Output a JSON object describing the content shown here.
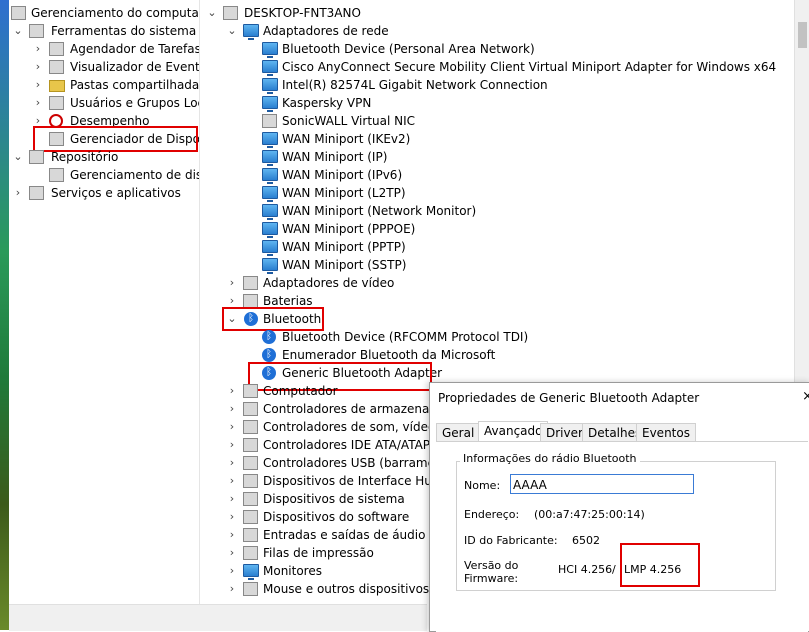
{
  "left_tree": {
    "root": "Gerenciamento do computador",
    "ferramentas": "Ferramentas do sistema",
    "agendador": "Agendador de Tarefas",
    "visualizador": "Visualizador de Eventos",
    "pastas": "Pastas compartilhadas",
    "usuarios": "Usuários e Grupos Locais",
    "desempenho": "Desempenho",
    "gerenciador": "Gerenciador de Dispositivos",
    "repositorio": "Repositório",
    "gerenciador_disco": "Gerenciamento de disco",
    "servicos": "Serviços e aplicativos"
  },
  "device_tree": {
    "computer": "DESKTOP-FNT3ANO",
    "network_category": "Adaptadores de rede",
    "network_items": [
      "Bluetooth Device (Personal Area Network)",
      "Cisco AnyConnect Secure Mobility Client Virtual Miniport Adapter for Windows x64",
      "Intel(R) 82574L Gigabit Network Connection",
      "Kaspersky VPN",
      "SonicWALL Virtual NIC",
      "WAN Miniport (IKEv2)",
      "WAN Miniport (IP)",
      "WAN Miniport (IPv6)",
      "WAN Miniport (L2TP)",
      "WAN Miniport (Network Monitor)",
      "WAN Miniport (PPPOE)",
      "WAN Miniport (PPTP)",
      "WAN Miniport (SSTP)"
    ],
    "video": "Adaptadores de vídeo",
    "baterias": "Baterias",
    "bluetooth": "Bluetooth",
    "bluetooth_items": [
      "Bluetooth Device (RFCOMM Protocol TDI)",
      "Enumerador Bluetooth da Microsoft",
      "Generic Bluetooth Adapter"
    ],
    "other_categories": [
      "Computador",
      "Controladores de armazenamento",
      "Controladores de som, vídeo e jogos",
      "Controladores IDE ATA/ATAPI",
      "Controladores USB (barramento serial universal)",
      "Dispositivos de Interface Humana",
      "Dispositivos de sistema",
      "Dispositivos do software",
      "Entradas e saídas de áudio",
      "Filas de impressão",
      "Monitores",
      "Mouse e outros dispositivos apontadores"
    ]
  },
  "dialog": {
    "title": "Propriedades de Generic Bluetooth Adapter",
    "close": "×",
    "tabs": [
      "Geral",
      "Avançado",
      "Driver",
      "Detalhes",
      "Eventos"
    ],
    "group_label": "Informações do rádio Bluetooth",
    "nome_label": "Nome:",
    "nome_value": "AAAA",
    "endereco_label": "Endereço:",
    "endereco_value": "(00:a7:47:25:00:14)",
    "fabricante_label": "ID do Fabricante:",
    "fabricante_value": "6502",
    "versao_label_1": "Versão do",
    "versao_label_2": "Firmware:",
    "hci": "HCI 4.256",
    "sep": "/",
    "lmp": "LMP 4.256"
  }
}
